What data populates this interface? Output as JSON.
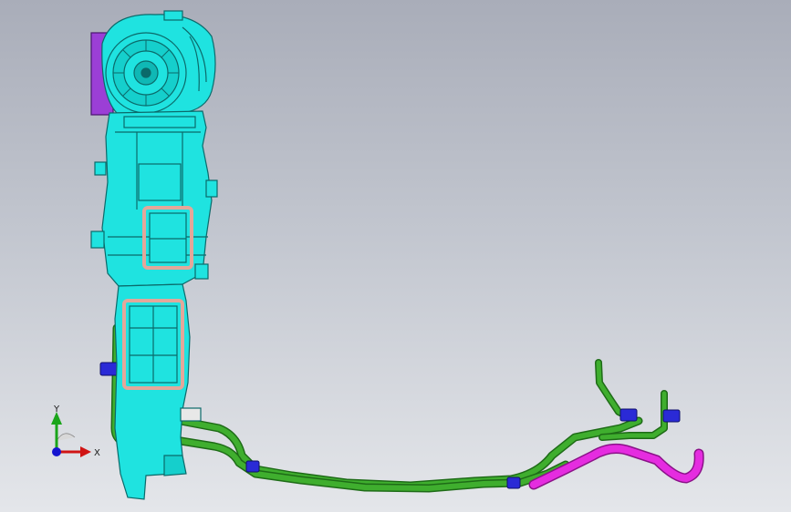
{
  "scene": {
    "model_name": "",
    "colors": {
      "housing": "#1fe3e0",
      "housing_outline": "#0b6a6a",
      "blower_plate": "#9b3fd6",
      "frame": "#e3a79a",
      "pipe_green": "#3fae2e",
      "pipe_green_outline": "#1e6b17",
      "hose_magenta": "#e52ce0",
      "clip_blue": "#2a2ad6",
      "background_top": "#a9adb9",
      "background_bottom": "#e4e6ea"
    }
  },
  "triad": {
    "y_label": "Y",
    "x_label": "X",
    "y_color": "#1aa51a",
    "x_color": "#d01414",
    "z_color": "#1515d0"
  }
}
